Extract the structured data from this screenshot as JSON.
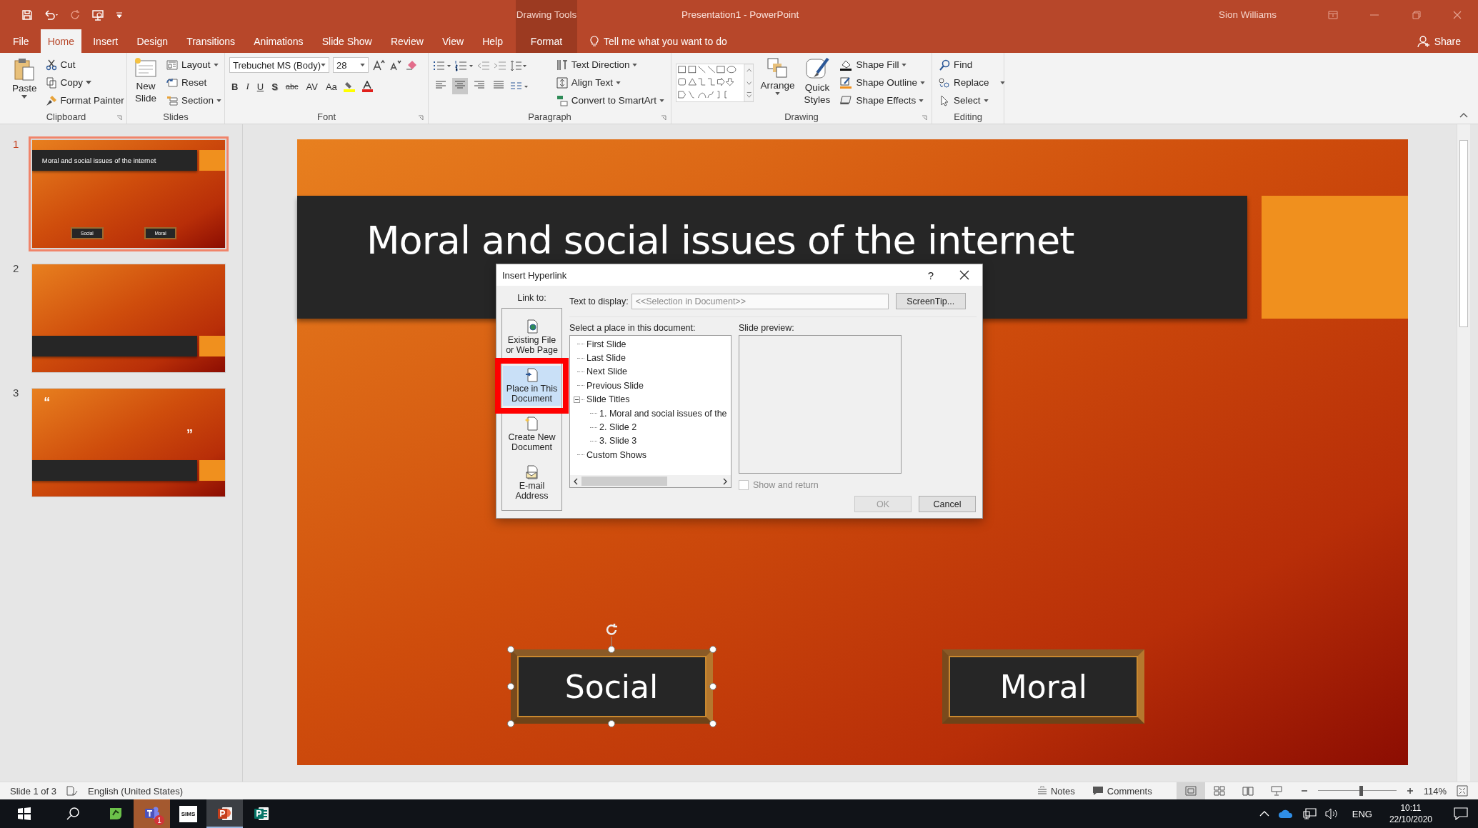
{
  "window": {
    "context_label": "Drawing Tools",
    "title": "Presentation1  -  PowerPoint",
    "user": "Sion Williams"
  },
  "tabs": [
    {
      "label": "File",
      "selected": false
    },
    {
      "label": "Home",
      "selected": true
    },
    {
      "label": "Insert",
      "selected": false
    },
    {
      "label": "Design",
      "selected": false
    },
    {
      "label": "Transitions",
      "selected": false
    },
    {
      "label": "Animations",
      "selected": false
    },
    {
      "label": "Slide Show",
      "selected": false
    },
    {
      "label": "Review",
      "selected": false
    },
    {
      "label": "View",
      "selected": false
    },
    {
      "label": "Help",
      "selected": false
    }
  ],
  "context_tab": {
    "label": "Format",
    "selected": false
  },
  "tell_me": "Tell me what you want to do",
  "share": "Share",
  "ribbon": {
    "clipboard": {
      "label": "Clipboard",
      "paste": "Paste",
      "cut": "Cut",
      "copy": "Copy",
      "format_painter": "Format Painter"
    },
    "slides": {
      "label": "Slides",
      "new_slide": "New Slide",
      "layout": "Layout",
      "reset": "Reset",
      "section": "Section"
    },
    "font": {
      "label": "Font",
      "font_name": "Trebuchet MS (Body)",
      "font_size": "28",
      "bold": "B",
      "italic": "I",
      "underline": "U",
      "shadow": "S",
      "strikethrough": "abc",
      "spacing": "AV",
      "change_case": "Aa"
    },
    "paragraph": {
      "label": "Paragraph",
      "align_buttons": [
        {
          "selected": false
        },
        {
          "selected": true
        },
        {
          "selected": false
        },
        {
          "selected": false
        }
      ],
      "text_direction": "Text Direction",
      "align_text": "Align Text",
      "convert_smartart": "Convert to SmartArt"
    },
    "drawing": {
      "label": "Drawing",
      "arrange": "Arrange",
      "quick_styles": "Quick Styles",
      "shape_fill": "Shape Fill",
      "shape_outline": "Shape Outline",
      "shape_effects": "Shape Effects"
    },
    "editing": {
      "label": "Editing",
      "find": "Find",
      "replace": "Replace",
      "select": "Select"
    }
  },
  "thumbnails": [
    {
      "number": "1",
      "selected": true,
      "kind": "title",
      "title": "Moral and social issues of the internet",
      "buttons": [
        "Social",
        "Moral"
      ]
    },
    {
      "number": "2",
      "selected": false,
      "kind": "section"
    },
    {
      "number": "3",
      "selected": false,
      "kind": "quote",
      "open_quote": "“",
      "close_quote": "”"
    }
  ],
  "slide": {
    "title": "Moral and social issues of the internet",
    "buttons": [
      {
        "label": "Social",
        "selected": true
      },
      {
        "label": "Moral",
        "selected": false
      }
    ]
  },
  "dialog": {
    "title": "Insert Hyperlink",
    "help": "?",
    "link_to_label": "Link to:",
    "link_to": [
      {
        "label": "Existing File or Web Page",
        "selected": false
      },
      {
        "label": "Place in This Document",
        "selected": true
      },
      {
        "label": "Create New Document",
        "selected": false
      },
      {
        "label": "E-mail Address",
        "selected": false
      }
    ],
    "text_to_display": {
      "label": "Text to display:",
      "value": "<<Selection in Document>>",
      "disabled": true
    },
    "screentip": "ScreenTip...",
    "place_label": "Select a place in this document:",
    "tree": [
      {
        "label": "First Slide"
      },
      {
        "label": "Last Slide"
      },
      {
        "label": "Next Slide"
      },
      {
        "label": "Previous Slide"
      },
      {
        "label": "Slide Titles",
        "expanded": true,
        "children": [
          {
            "label": "1. Moral and social issues of the"
          },
          {
            "label": "2. Slide 2"
          },
          {
            "label": "3. Slide 3"
          }
        ]
      },
      {
        "label": "Custom Shows"
      }
    ],
    "preview_label": "Slide preview:",
    "show_and_return": {
      "label": "Show and return",
      "checked": false,
      "disabled": true
    },
    "ok": {
      "label": "OK",
      "disabled": true
    },
    "cancel": {
      "label": "Cancel",
      "disabled": false
    }
  },
  "status_bar": {
    "slide_count": "Slide 1 of 3",
    "language": "English (United States)",
    "notes": "Notes",
    "comments": "Comments",
    "views": [
      {
        "selected": true
      },
      {
        "selected": false
      },
      {
        "selected": false
      },
      {
        "selected": false
      }
    ],
    "zoom": {
      "level": 0.55
    },
    "zoom_reading": "114%"
  },
  "taskbar": {
    "apps": [
      {
        "attention": false,
        "active": false
      },
      {
        "attention": true,
        "active": false,
        "badge": "1"
      },
      {
        "attention": false,
        "active": false,
        "label": "SIMS"
      },
      {
        "attention": false,
        "active": true
      },
      {
        "attention": false,
        "active": false
      }
    ],
    "language": "ENG",
    "time": "10:11",
    "date": "22/10/2020"
  }
}
